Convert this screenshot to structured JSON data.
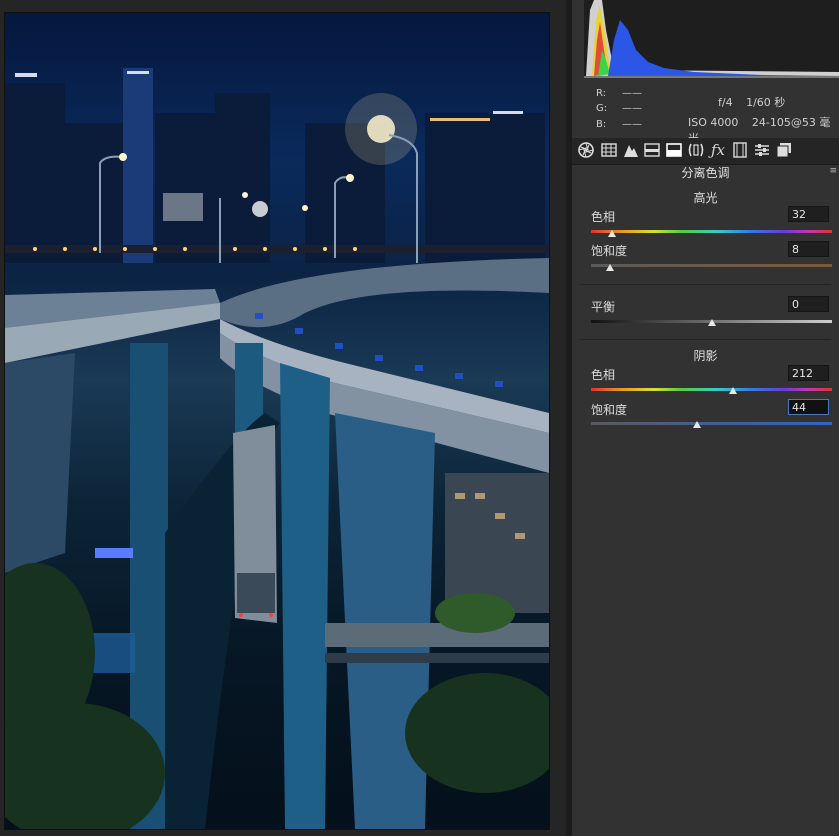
{
  "info": {
    "rgb": [
      {
        "label": "R:",
        "value": "——"
      },
      {
        "label": "G:",
        "value": "——"
      },
      {
        "label": "B:",
        "value": "——"
      }
    ],
    "aperture": "f/4",
    "shutter": "1/60 秒",
    "iso": "ISO 4000",
    "lens": "24-105@53 毫米"
  },
  "tabs": [
    {
      "icon": "aperture-icon"
    },
    {
      "icon": "tone-curve-grid-icon"
    },
    {
      "icon": "mountain-detail-icon"
    },
    {
      "icon": "hsl-icon"
    },
    {
      "icon": "split-toning-icon"
    },
    {
      "icon": "lens-correction-icon"
    },
    {
      "icon": "fx-icon"
    },
    {
      "icon": "camera-calibration-icon"
    },
    {
      "icon": "presets-icon"
    },
    {
      "icon": "snapshots-icon"
    }
  ],
  "panel": {
    "title": "分离色调",
    "menu": "≡",
    "highlights": {
      "title": "高光",
      "hue": {
        "label": "色相",
        "value": "32",
        "fraction": 0.089
      },
      "saturation": {
        "label": "饱和度",
        "value": "8",
        "fraction": 0.08
      }
    },
    "balance": {
      "label": "平衡",
      "value": "0",
      "fraction": 0.5
    },
    "shadows": {
      "title": "阴影",
      "hue": {
        "label": "色相",
        "value": "212",
        "fraction": 0.589
      },
      "saturation": {
        "label": "饱和度",
        "value": "44",
        "fraction": 0.44
      }
    }
  },
  "colors": {
    "panel_bg": "#323232",
    "active_field_border": "#4a78c8"
  }
}
